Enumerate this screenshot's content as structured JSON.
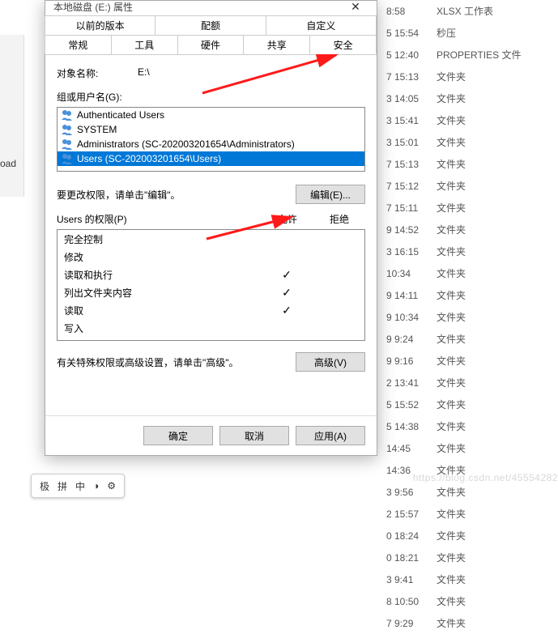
{
  "dialog": {
    "title": "本地磁盘 (E:) 属性",
    "close": "✕",
    "tabs_row1": [
      "以前的版本",
      "配额",
      "自定义"
    ],
    "tabs_row2": [
      "常规",
      "工具",
      "硬件",
      "共享",
      "安全"
    ],
    "active_tab": "安全",
    "object_label": "对象名称:",
    "object_value": "E:\\",
    "group_label": "组或用户名(G):",
    "users": [
      {
        "name": "Authenticated Users",
        "sel": false
      },
      {
        "name": "SYSTEM",
        "sel": false
      },
      {
        "name": "Administrators (SC-202003201654\\Administrators)",
        "sel": false
      },
      {
        "name": "Users (SC-202003201654\\Users)",
        "sel": true
      }
    ],
    "edit_hint": "要更改权限，请单击\"编辑\"。",
    "edit_btn": "编辑(E)...",
    "perm_label": "Users 的权限(P)",
    "perm_allow": "允许",
    "perm_deny": "拒绝",
    "perms": [
      {
        "n": "完全控制",
        "a": false,
        "d": false
      },
      {
        "n": "修改",
        "a": false,
        "d": false
      },
      {
        "n": "读取和执行",
        "a": true,
        "d": false
      },
      {
        "n": "列出文件夹内容",
        "a": true,
        "d": false
      },
      {
        "n": "读取",
        "a": true,
        "d": false
      },
      {
        "n": "写入",
        "a": false,
        "d": false
      }
    ],
    "adv_hint": "有关特殊权限或高级设置，请单击\"高级\"。",
    "adv_btn": "高级(V)",
    "btns": {
      "ok": "确定",
      "cancel": "取消",
      "apply": "应用(A)"
    }
  },
  "bg": [
    {
      "t": "8:58",
      "ty": "XLSX 工作表"
    },
    {
      "t": "5 15:54",
      "ty": "秒压"
    },
    {
      "t": "5 12:40",
      "ty": "PROPERTIES 文件"
    },
    {
      "t": "7 15:13",
      "ty": "文件夹"
    },
    {
      "t": "3 14:05",
      "ty": "文件夹"
    },
    {
      "t": "3 15:41",
      "ty": "文件夹"
    },
    {
      "t": "3 15:01",
      "ty": "文件夹"
    },
    {
      "t": "7 15:13",
      "ty": "文件夹"
    },
    {
      "t": "7 15:12",
      "ty": "文件夹"
    },
    {
      "t": "7 15:11",
      "ty": "文件夹"
    },
    {
      "t": "9 14:52",
      "ty": "文件夹"
    },
    {
      "t": "3 16:15",
      "ty": "文件夹"
    },
    {
      "t": "10:34",
      "ty": "文件夹"
    },
    {
      "t": "9 14:11",
      "ty": "文件夹"
    },
    {
      "t": "9 10:34",
      "ty": "文件夹"
    },
    {
      "t": "9 9:24",
      "ty": "文件夹"
    },
    {
      "t": "9 9:16",
      "ty": "文件夹"
    },
    {
      "t": "2 13:41",
      "ty": "文件夹"
    },
    {
      "t": "5 15:52",
      "ty": "文件夹"
    },
    {
      "t": "5 14:38",
      "ty": "文件夹"
    },
    {
      "t": "14:45",
      "ty": "文件夹"
    },
    {
      "t": "14:36",
      "ty": "文件夹"
    },
    {
      "t": "3 9:56",
      "ty": "文件夹"
    },
    {
      "t": "2 15:57",
      "ty": "文件夹"
    },
    {
      "t": "0 18:24",
      "ty": "文件夹"
    },
    {
      "t": "0 18:21",
      "ty": "文件夹"
    },
    {
      "t": "3 9:41",
      "ty": "文件夹"
    },
    {
      "t": "8 10:50",
      "ty": "文件夹"
    },
    {
      "t": "7 9:29",
      "ty": "文件夹"
    }
  ],
  "left_text": "oad",
  "ime": [
    "极",
    "拼",
    "中"
  ],
  "watermark": "https://blog.csdn.net/45554282"
}
